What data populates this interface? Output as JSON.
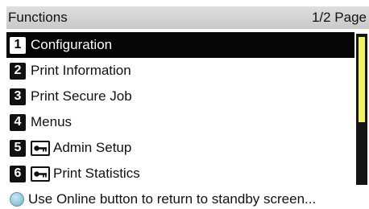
{
  "header": {
    "title": "Functions",
    "page_indicator": "1/2 Page"
  },
  "menu": {
    "items": [
      {
        "number": "1",
        "label": "Configuration",
        "locked": false,
        "selected": true
      },
      {
        "number": "2",
        "label": "Print Information",
        "locked": false,
        "selected": false
      },
      {
        "number": "3",
        "label": "Print Secure Job",
        "locked": false,
        "selected": false
      },
      {
        "number": "4",
        "label": "Menus",
        "locked": false,
        "selected": false
      },
      {
        "number": "5",
        "label": "Admin Setup",
        "locked": true,
        "selected": false
      },
      {
        "number": "6",
        "label": "Print Statistics",
        "locked": true,
        "selected": false
      }
    ]
  },
  "footer": {
    "hint": "Use Online button to return to standby screen..."
  },
  "icons": {
    "lock": "key-icon",
    "online": "online-button-icon"
  },
  "colors": {
    "selected_bg": "#050505",
    "scroll_thumb": "#f4f45a",
    "online_button": "#6fb2c8"
  },
  "scroll": {
    "visible_fraction": 0.55,
    "position": 0
  }
}
